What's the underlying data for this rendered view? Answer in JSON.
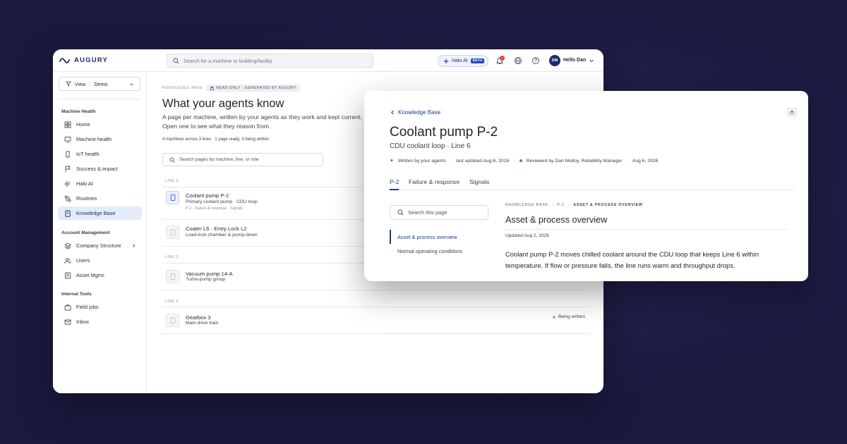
{
  "app": {
    "brand": "AUGURY",
    "search_placeholder": "Search for a machine or building/facility",
    "halo": {
      "label": "Halo AI",
      "badge": "BETA"
    },
    "notifications_count": "2",
    "user": {
      "initials": "DM",
      "greeting": "Hello Dan"
    }
  },
  "sidebar": {
    "view": {
      "label": "View",
      "value": "Demo"
    },
    "sections": [
      {
        "title": "Machine Health",
        "items": [
          {
            "label": "Home",
            "icon": "grid-icon"
          },
          {
            "label": "Machine health",
            "icon": "monitor-icon"
          },
          {
            "label": "IoT health",
            "icon": "device-icon"
          },
          {
            "label": "Success & impact",
            "icon": "flag-icon"
          },
          {
            "label": "Halo AI",
            "icon": "sparkle-icon"
          },
          {
            "label": "Routines",
            "icon": "routine-icon"
          },
          {
            "label": "Knowledge Base",
            "icon": "book-icon",
            "active": true
          }
        ]
      },
      {
        "title": "Account Management",
        "items": [
          {
            "label": "Company Structure",
            "icon": "layers-icon"
          },
          {
            "label": "Users",
            "icon": "users-icon"
          },
          {
            "label": "Asset Mgmt.",
            "icon": "asset-icon"
          }
        ]
      },
      {
        "title": "Internal Tools",
        "items": [
          {
            "label": "Field jobs",
            "icon": "briefcase-icon"
          },
          {
            "label": "Inbox",
            "icon": "mail-icon"
          }
        ]
      }
    ]
  },
  "kb": {
    "breadcrumb": "KNOWLEDGE BASE",
    "readonly_badge": "READ-ONLY · GENERATED BY AUGURY",
    "title": "What your agents know",
    "description": "A page per machine, written by your agents as they work and kept current. Open one to see what they reason from.",
    "meta": "4 machines across 3 lines · 1 page ready, 3 being written",
    "search_placeholder": "Search pages by machine, line, or role",
    "groups": [
      {
        "line": "LINE 6",
        "rows": [
          {
            "name": "Coolant pump P-2",
            "sub": "Primary coolant pump · CDU loop",
            "tags": "P-2 · Failure & response · Signals",
            "active": true
          },
          {
            "name": "Coater L6 · Entry Lock L2",
            "sub": "Load-lock chamber & pump-down"
          }
        ]
      },
      {
        "line": "LINE 3",
        "rows": [
          {
            "name": "Vacuum pump 14-A",
            "sub": "Turbo-pump group"
          }
        ]
      },
      {
        "line": "LINE 5",
        "rows": [
          {
            "name": "Gearbox 3",
            "sub": "Main drive train",
            "status": "Being written"
          }
        ]
      }
    ]
  },
  "detail": {
    "back_label": "Knowledge Base",
    "title": "Coolant pump P-2",
    "subtitle": "CDU coolant loop · Line 6",
    "meta": {
      "written_by": "Written by your agents",
      "last_updated": "last updated Aug 6, 2026",
      "reviewed_by": "Reviewed by Dan Molloy, Reliability Manager",
      "reviewed_date": "Aug 6, 2026"
    },
    "tabs": [
      "P-2",
      "Failure & response",
      "Signals"
    ],
    "search_placeholder": "Search this page",
    "toc": [
      "Asset & process overview",
      "Normal operating conditions"
    ],
    "doc_crumbs": [
      "KNOWLEDGE BASE",
      "P-2",
      "ASSET & PROCESS OVERVIEW"
    ],
    "section_title": "Asset & process overview",
    "updated": "Updated Aug 2, 2026",
    "body": "Coolant pump P-2 moves chilled coolant around the CDU loop that keeps Line 6 within temperature. If flow or pressure falls, the line runs warm and throughput drops."
  },
  "colors": {
    "background": "#1a1a3f",
    "accent": "#1d3a8a",
    "active_nav": "#e4ecf9",
    "reviewed_dot": "#2e9e5b"
  }
}
